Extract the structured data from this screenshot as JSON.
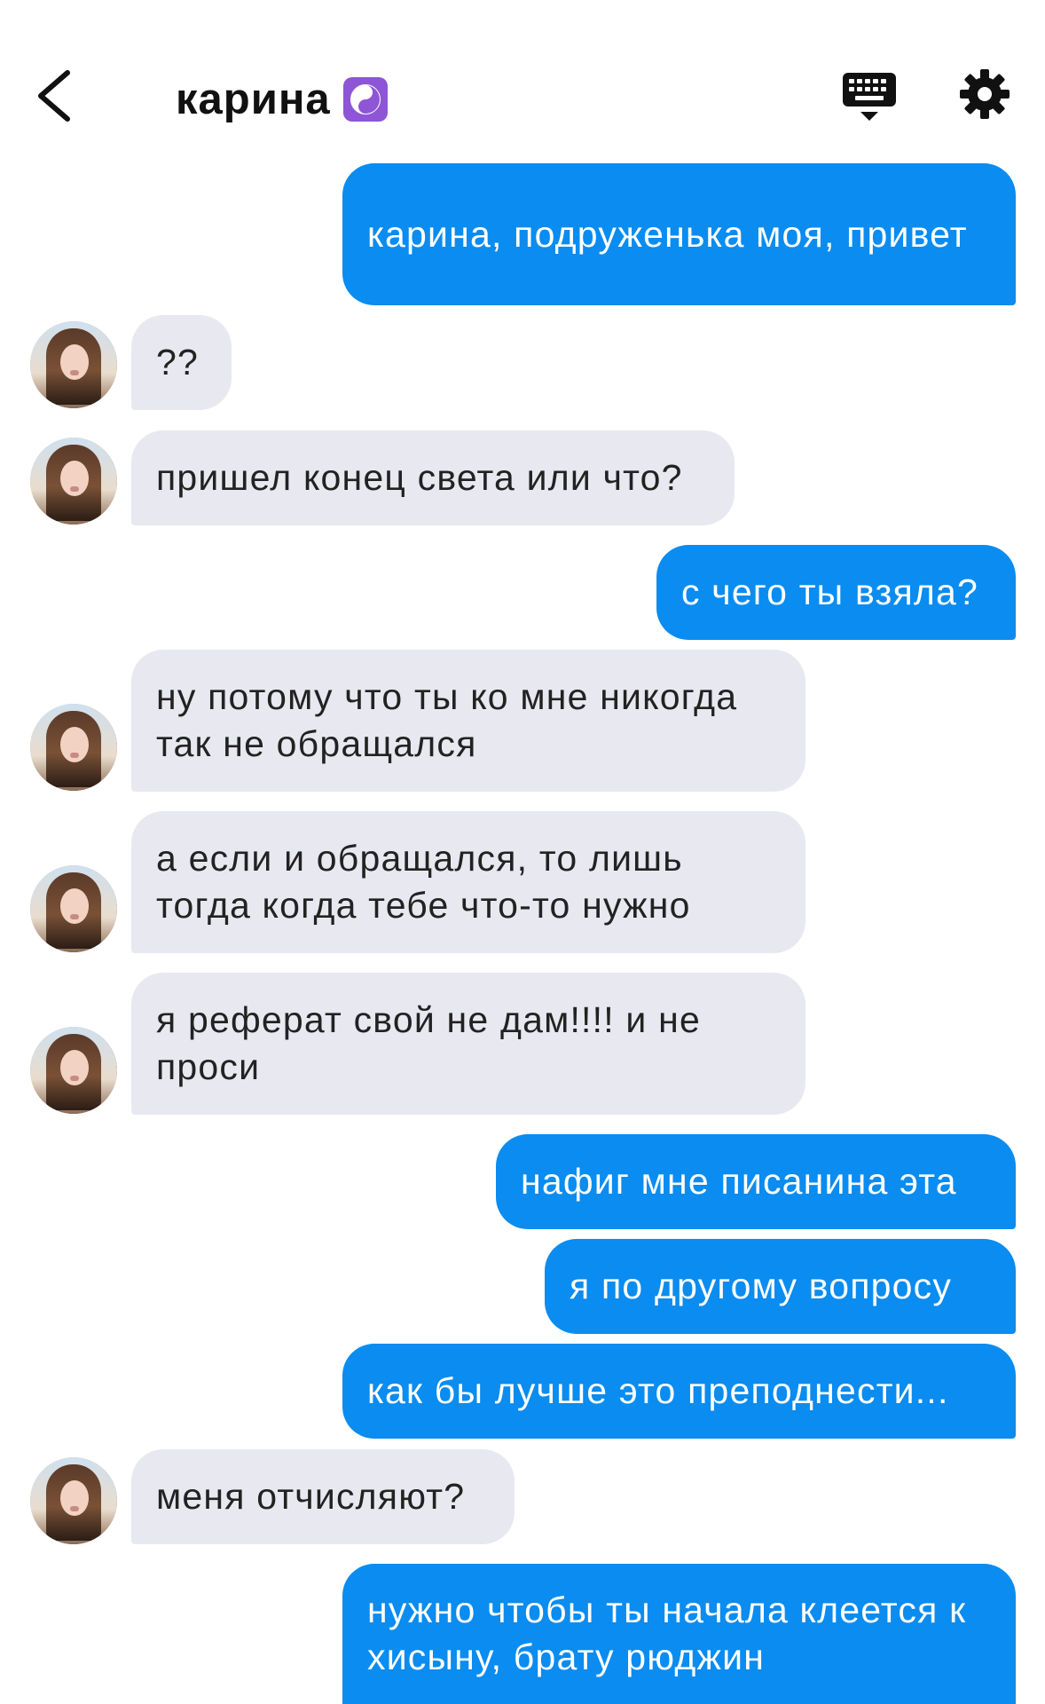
{
  "header": {
    "title": "карина",
    "title_emoji": "yin-yang-icon"
  },
  "colors": {
    "outgoing_bubble": "#0a8cf0",
    "incoming_bubble": "#e8e8f0",
    "accent_purple": "#8e55d6"
  },
  "messages": [
    {
      "direction": "out",
      "text": "карина, подруженька моя, привет"
    },
    {
      "direction": "in",
      "text": "??"
    },
    {
      "direction": "in",
      "text": "пришел конец света или что?"
    },
    {
      "direction": "out",
      "text": "с чего ты взяла?"
    },
    {
      "direction": "in",
      "text": "ну потому что ты ко мне никогда так не обращался"
    },
    {
      "direction": "in",
      "text": "а если и обращался, то лишь тогда когда тебе что-то нужно"
    },
    {
      "direction": "in",
      "text": "я реферат свой не дам!!!! и не проси"
    },
    {
      "direction": "out",
      "text": "нафиг мне писанина эта"
    },
    {
      "direction": "out",
      "text": "я по другому вопросу"
    },
    {
      "direction": "out",
      "text": "как бы лучше это преподнести..."
    },
    {
      "direction": "in",
      "text": "меня отчисляют?"
    },
    {
      "direction": "out",
      "text": "нужно чтобы ты начала клеется к хисыну, брату рюджин"
    }
  ]
}
